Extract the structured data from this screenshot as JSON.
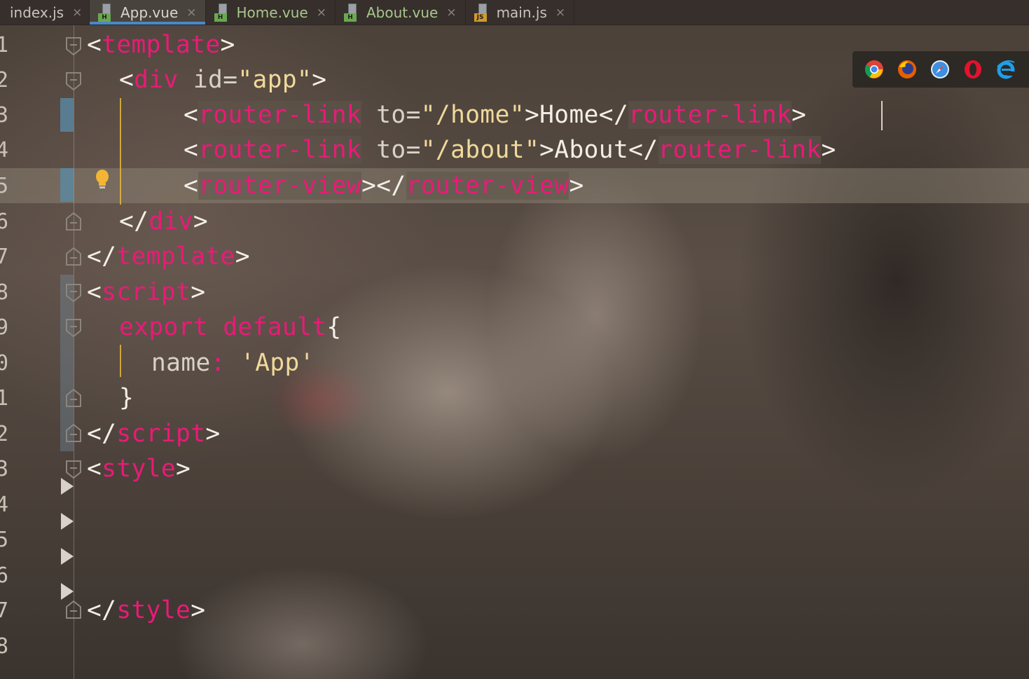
{
  "tabs": [
    {
      "label": "index.js",
      "icon": "js-file-icon",
      "active": false
    },
    {
      "label": "App.vue",
      "icon": "vue-file-icon",
      "active": true
    },
    {
      "label": "Home.vue",
      "icon": "vue-file-icon",
      "active": false
    },
    {
      "label": "About.vue",
      "icon": "vue-file-icon",
      "active": false
    },
    {
      "label": "main.js",
      "icon": "js-file-icon",
      "active": false
    }
  ],
  "tab_close_glyph": "×",
  "file_badges": {
    "vue": "H",
    "js": "JS"
  },
  "browser_icons": [
    "chrome-icon",
    "firefox-icon",
    "safari-icon",
    "opera-icon",
    "ie-icon"
  ],
  "line_numbers": [
    "1",
    "2",
    "3",
    "4",
    "5",
    "6",
    "7",
    "8",
    "9",
    "0",
    "1",
    "2",
    "3",
    "4",
    "5",
    "6",
    "7",
    "8"
  ],
  "code": {
    "l1": {
      "open": "<",
      "tag": "template",
      "close": ">"
    },
    "l2": {
      "open": "<",
      "tag": "div",
      "attr": " id=",
      "val": "\"app\"",
      "close": ">"
    },
    "l3": {
      "open": "<",
      "tag": "router-link",
      "attr": " to=",
      "val": "\"/home\"",
      "mid": ">Home</",
      "tag2": "router-link",
      "close": ">"
    },
    "l4": {
      "open": "<",
      "tag": "router-link",
      "attr": " to=",
      "val": "\"/about\"",
      "mid": ">About</",
      "tag2": "router-link",
      "close": ">"
    },
    "l5": {
      "open": "<",
      "tag": "router-view",
      "mid": "></",
      "tag2": "router-view",
      "close": ">"
    },
    "l6": {
      "open": "</",
      "tag": "div",
      "close": ">"
    },
    "l7": {
      "open": "</",
      "tag": "template",
      "close": ">"
    },
    "l8": {
      "open": "<",
      "tag": "script",
      "close": ">"
    },
    "l9": {
      "kw1": "export",
      "kw2": "default",
      "brace": "{"
    },
    "l10": {
      "key": "name",
      "colon": ":",
      "val": "'App'"
    },
    "l11": {
      "brace": "}"
    },
    "l12": {
      "open": "</",
      "tag": "script",
      "close": ">"
    },
    "l13": {
      "open": "<",
      "tag": "style",
      "close": ">"
    },
    "l17": {
      "open": "</",
      "tag": "style",
      "close": ">"
    }
  },
  "colors": {
    "tag": "#ea1a78",
    "string": "#f0d99a",
    "text": "#ece6dc",
    "active_tab_underline": "#4a88c7"
  }
}
